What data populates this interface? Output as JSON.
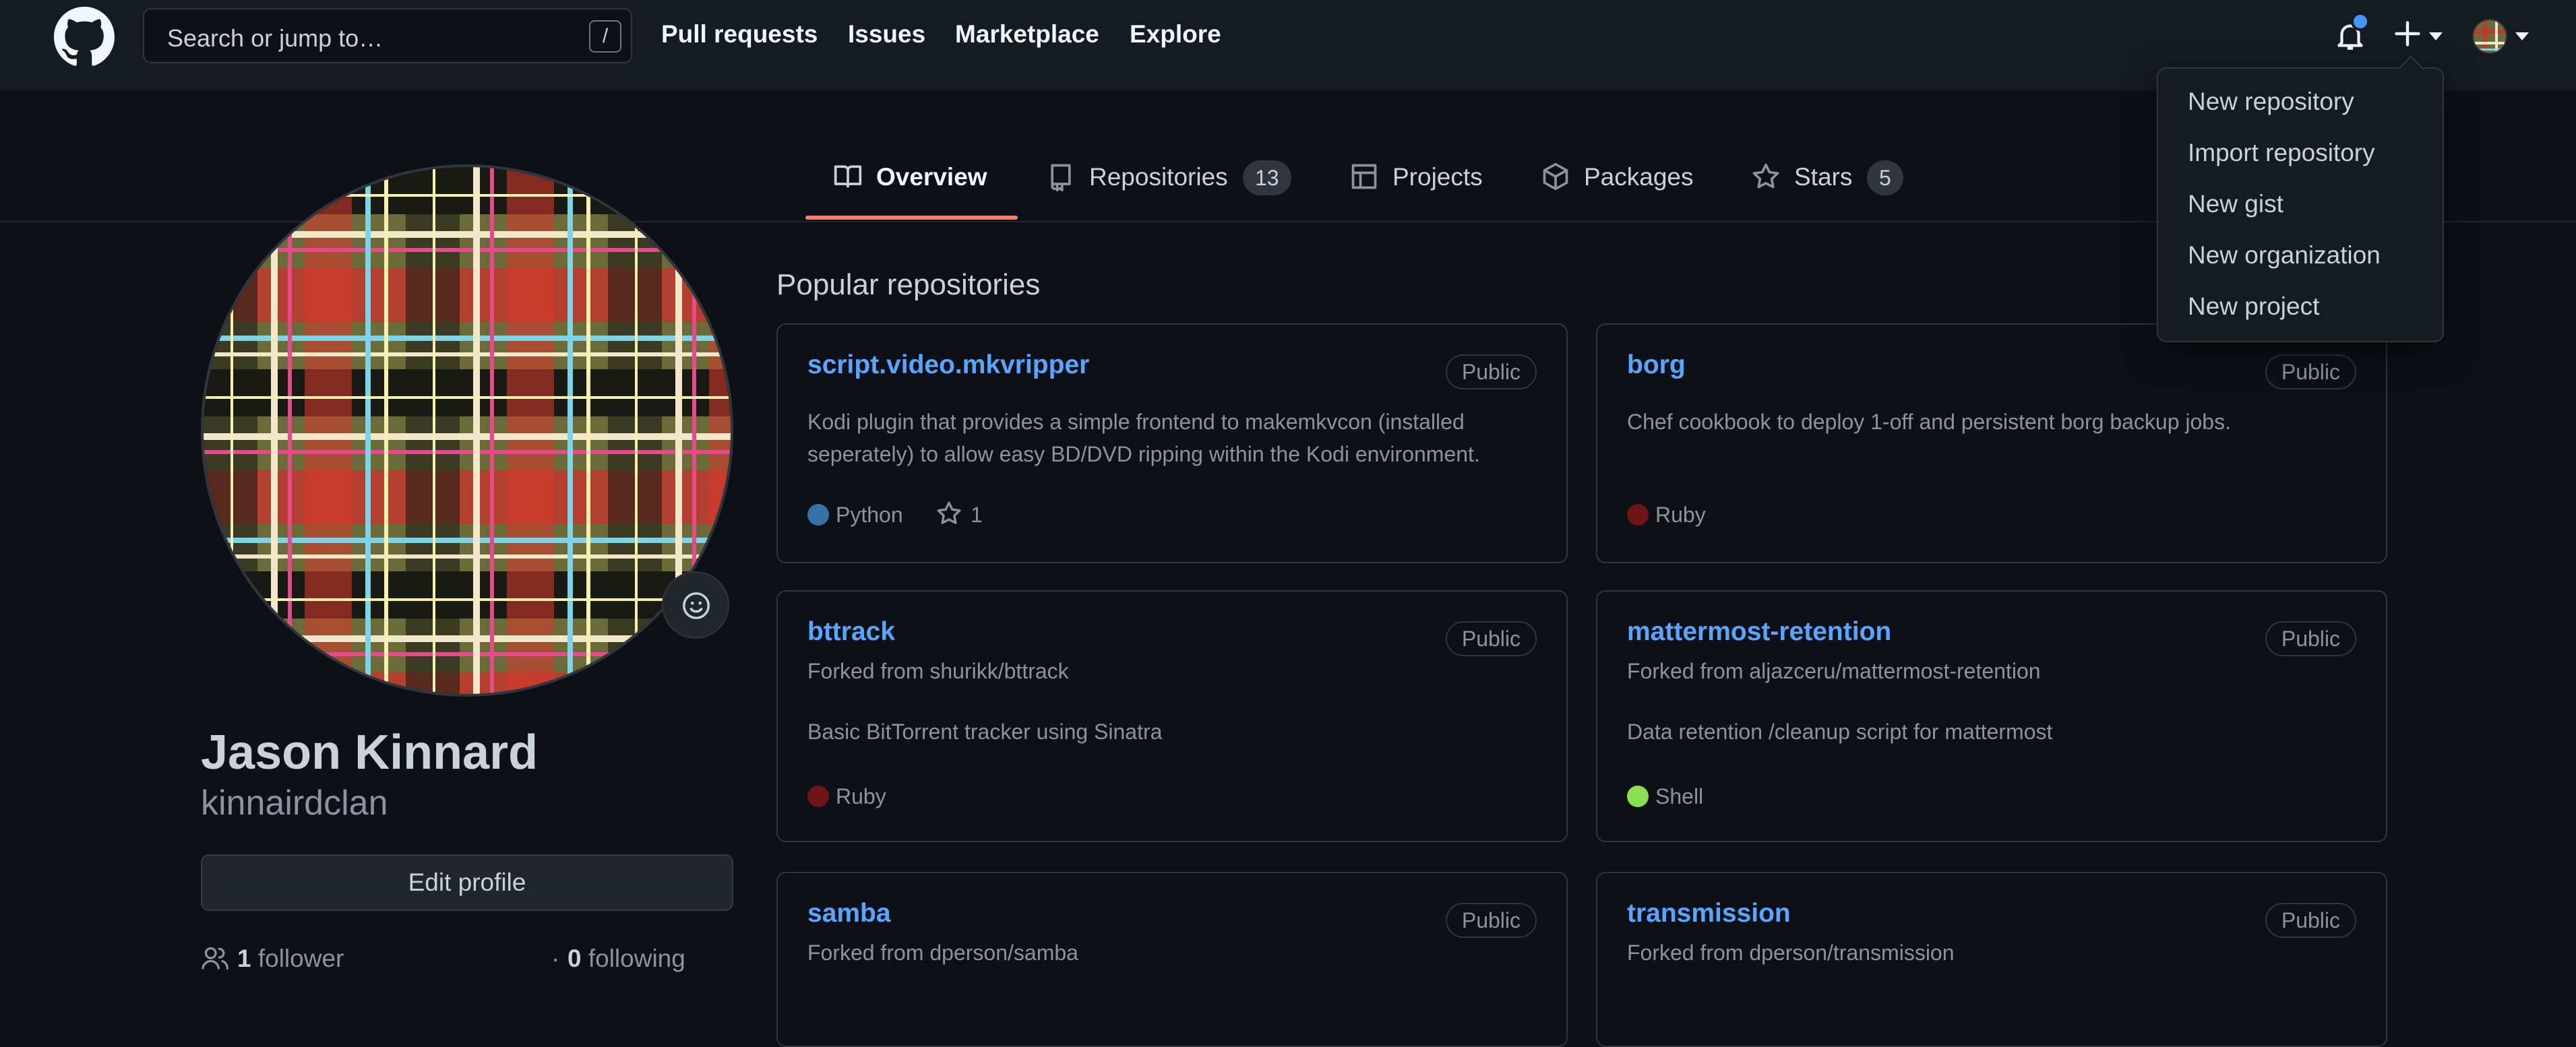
{
  "header": {
    "search_placeholder": "Search or jump to…",
    "search_shortcut": "/",
    "nav": [
      "Pull requests",
      "Issues",
      "Marketplace",
      "Explore"
    ]
  },
  "create_menu": {
    "items": [
      "New repository",
      "Import repository",
      "New gist",
      "New organization",
      "New project"
    ]
  },
  "tabs": [
    {
      "label": "Overview",
      "count": null,
      "icon": "book-icon",
      "active": true
    },
    {
      "label": "Repositories",
      "count": "13",
      "icon": "repo-icon",
      "active": false
    },
    {
      "label": "Projects",
      "count": null,
      "icon": "table-icon",
      "active": false
    },
    {
      "label": "Packages",
      "count": null,
      "icon": "package-icon",
      "active": false
    },
    {
      "label": "Stars",
      "count": "5",
      "icon": "star-icon",
      "active": false
    }
  ],
  "profile": {
    "name": "Jason Kinnard",
    "login": "kinnairdclan",
    "edit_button": "Edit profile",
    "followers_count": "1",
    "followers_label": "follower",
    "separator": "·",
    "following_count": "0",
    "following_label": "following"
  },
  "popular": {
    "title": "Popular repositories",
    "repos": [
      {
        "name": "script.video.mkvripper",
        "visibility": "Public",
        "forked_from": "",
        "description": "Kodi plugin that provides a simple frontend to makemkvcon (installed seperately) to allow easy BD/DVD ripping within the Kodi environment.",
        "language": "Python",
        "lang_color": "#3572A5",
        "stars": "1"
      },
      {
        "name": "borg",
        "visibility": "Public",
        "forked_from": "",
        "description": "Chef cookbook to deploy 1-off and persistent borg backup jobs.",
        "language": "Ruby",
        "lang_color": "#701516",
        "stars": ""
      },
      {
        "name": "bttrack",
        "visibility": "Public",
        "forked_from": "Forked from shurikk/bttrack",
        "description": "Basic BitTorrent tracker using Sinatra",
        "language": "Ruby",
        "lang_color": "#701516",
        "stars": ""
      },
      {
        "name": "mattermost-retention",
        "visibility": "Public",
        "forked_from": "Forked from aljazceru/mattermost-retention",
        "description": "Data retention /cleanup script for mattermost",
        "language": "Shell",
        "lang_color": "#89e051",
        "stars": ""
      },
      {
        "name": "samba",
        "visibility": "Public",
        "forked_from": "Forked from dperson/samba",
        "description": "",
        "language": "",
        "lang_color": "",
        "stars": ""
      },
      {
        "name": "transmission",
        "visibility": "Public",
        "forked_from": "Forked from dperson/transmission",
        "description": "",
        "language": "",
        "lang_color": "",
        "stars": ""
      }
    ]
  },
  "colors": {
    "page_bg": "#0d1117",
    "header_bg": "#161b22",
    "link": "#58a6ff",
    "active_tab": "#f78166",
    "notification_dot": "#4493f8"
  }
}
